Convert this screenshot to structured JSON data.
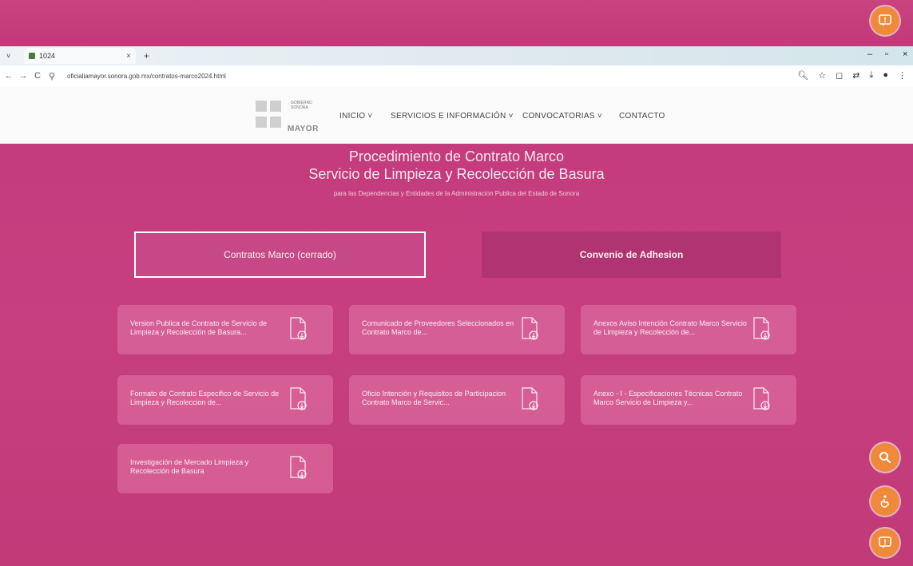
{
  "browser": {
    "tab_title": "1024",
    "tab_close": "×",
    "new_tab": "+",
    "url": "oficialiamayor.sonora.gob.mx/contratos-marco2024.html",
    "nav_back": "←",
    "nav_forward": "→",
    "nav_reload": "C"
  },
  "site": {
    "logo_text_top": "GOBIERNO SONORA",
    "logo_text_bottom": "MAYOR",
    "menu": [
      {
        "label": "INICIO ˅"
      },
      {
        "label": "SERVICIOS E INFORMACIÓN ˅"
      },
      {
        "label": "CONVOCATORIAS ˅"
      },
      {
        "label": "CONTACTO"
      }
    ]
  },
  "hero": {
    "title_line1": "Procedimiento de Contrato Marco",
    "title_line2": "Servicio de Limpieza y Recolección de Basura",
    "subtitle": "para las Dependencias y Entidades de la Administracion Publica del Estado de Sonora"
  },
  "tabs": {
    "left_label": "Contratos Marco (cerrado)",
    "right_label": "Convenio de Adhesion"
  },
  "documents": [
    {
      "label": "Version Publica de Contrato de Servicio de Limpieza y Recolección de Basura...",
      "icon": "document-download-icon"
    },
    {
      "label": "Comunicado de Proveedores Seleccionados en Contrato Marco de...",
      "icon": "document-download-icon"
    },
    {
      "label": "Anexos Aviso Intención Contrato Marco Servicio de Limpieza y Recolección de...",
      "icon": "document-download-icon"
    },
    {
      "label": "Formato de Contrato Especifico de Servicio de Limpieza y Recoleccion de...",
      "icon": "document-download-icon"
    },
    {
      "label": "Oficio Intención y Requisitos de Participacion Contrato Marco de Servic...",
      "icon": "document-download-icon"
    },
    {
      "label": "Anexo - I - Especificaciones Técnicas Contrato Marco Servicio de Limpieza y...",
      "icon": "document-download-icon"
    },
    {
      "label": "Investigación de Mercado Limpieza y Recolección de Basura",
      "icon": "document-download-icon"
    }
  ],
  "colors": {
    "background": "#c43a7c",
    "card": "#e378aa",
    "accent_float": "#ef8a3a"
  }
}
